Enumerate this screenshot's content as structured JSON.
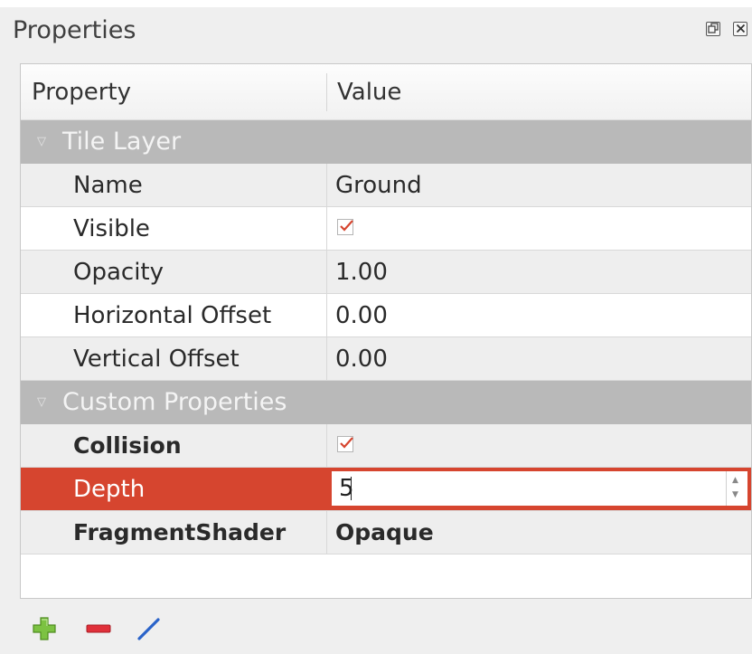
{
  "panel": {
    "title": "Properties"
  },
  "table": {
    "header": {
      "property": "Property",
      "value": "Value"
    },
    "groups": [
      {
        "label": "Tile Layer",
        "rows": [
          {
            "name": "Name",
            "value": "Ground"
          },
          {
            "name": "Visible",
            "checked": true
          },
          {
            "name": "Opacity",
            "value": "1.00"
          },
          {
            "name": "Horizontal Offset",
            "value": "0.00"
          },
          {
            "name": "Vertical Offset",
            "value": "0.00"
          }
        ]
      },
      {
        "label": "Custom Properties",
        "rows": [
          {
            "name": "Collision",
            "checked": true
          },
          {
            "name": "Depth",
            "value": "5",
            "selected": true,
            "editing": true
          },
          {
            "name": "FragmentShader",
            "value": "Opaque"
          }
        ]
      }
    ]
  },
  "toolbar": {
    "buttons": [
      {
        "icon": "plus-icon"
      },
      {
        "icon": "minus-icon"
      },
      {
        "icon": "pencil-icon"
      }
    ]
  },
  "colors": {
    "selection": "#d6452f",
    "group_header": "#b9b9b9",
    "check_mark": "#d6452f",
    "plus_green": "#7cc242",
    "minus_red": "#e0303a",
    "pencil_blue": "#2a63c9"
  }
}
